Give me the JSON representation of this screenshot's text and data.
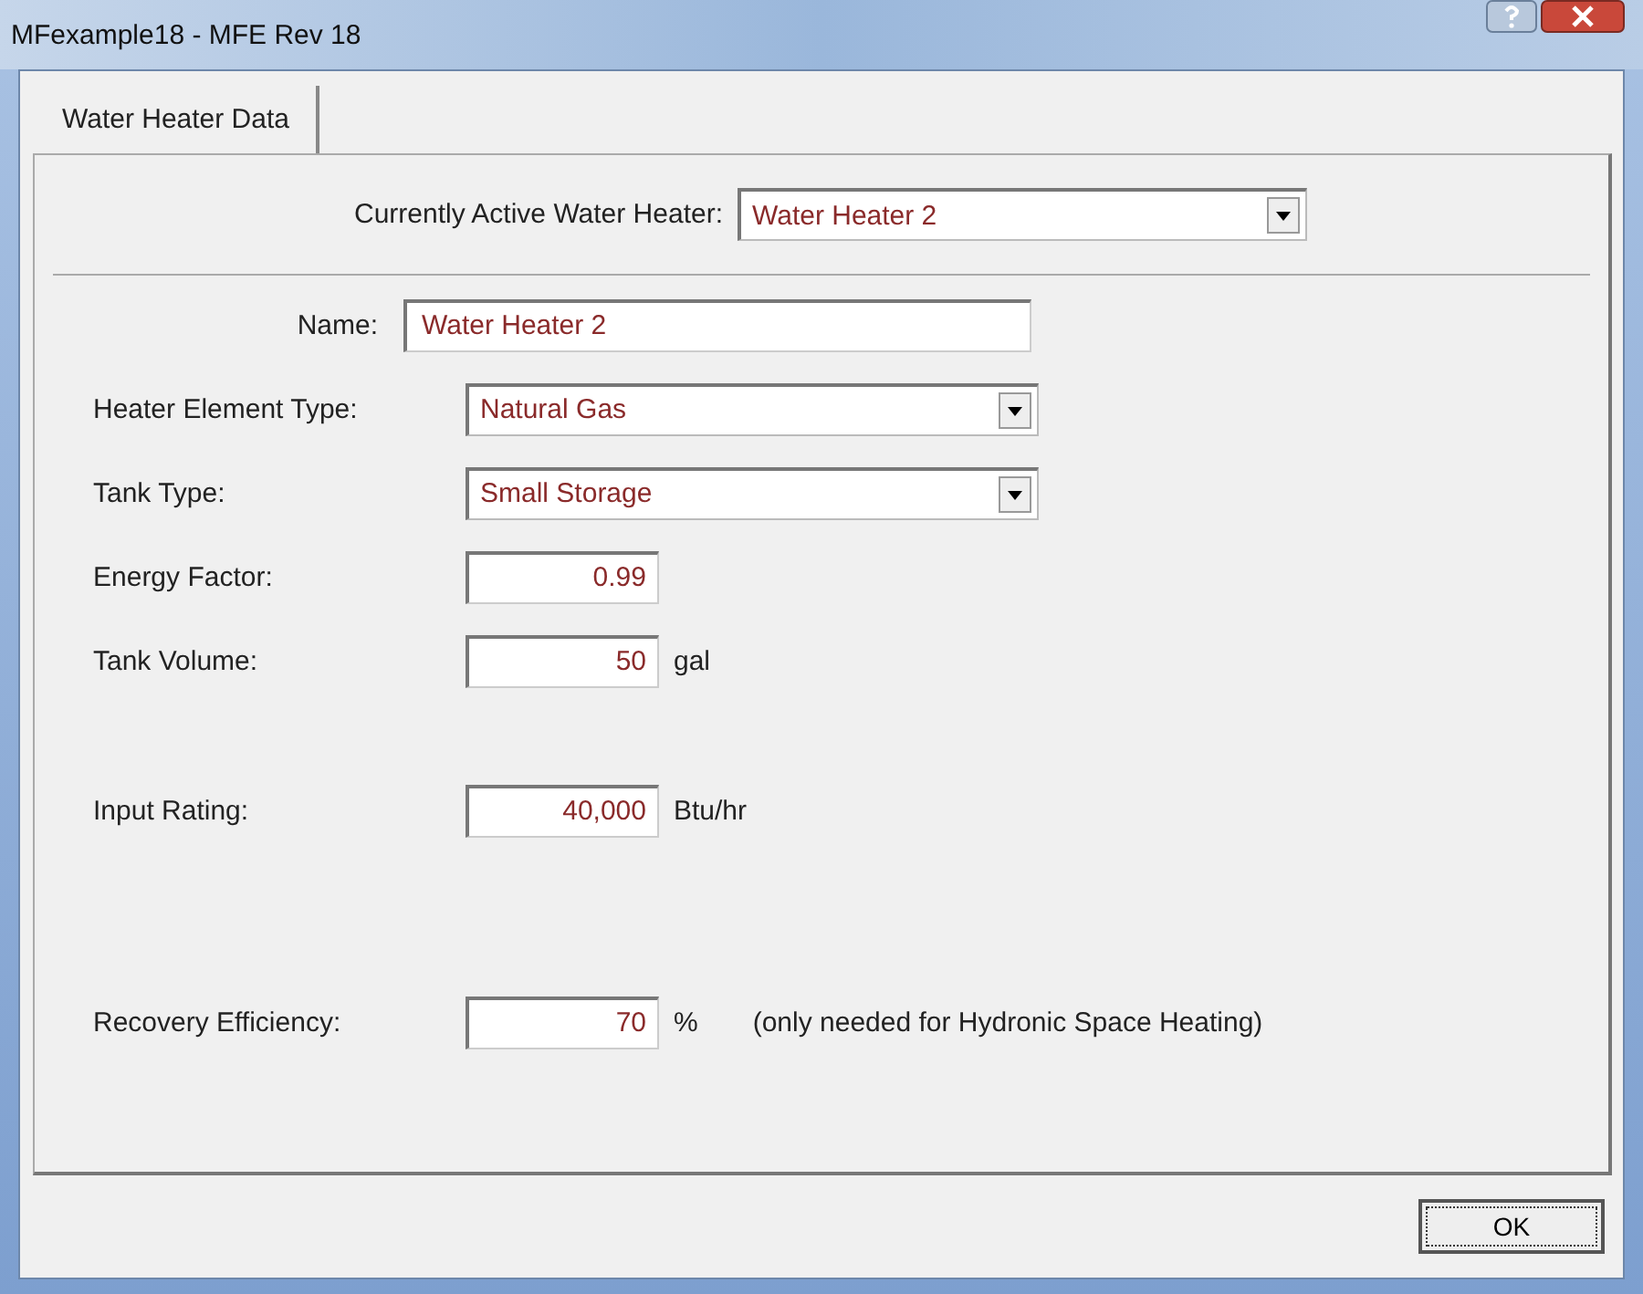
{
  "window": {
    "title": "MFexample18 - MFE Rev 18"
  },
  "tabs": [
    {
      "label": "Water Heater Data",
      "selected": true
    }
  ],
  "active_heater": {
    "label": "Currently Active Water Heater:",
    "value": "Water Heater 2"
  },
  "fields": [
    {
      "kind": "text",
      "label": "Name:",
      "value": "Water Heater 2"
    },
    {
      "kind": "select",
      "label": "Heater Element Type:",
      "value": "Natural Gas"
    },
    {
      "kind": "select",
      "label": "Tank Type:",
      "value": "Small Storage"
    },
    {
      "kind": "number",
      "label": "Energy Factor:",
      "value": "0.99"
    },
    {
      "kind": "number",
      "label": "Tank Volume:",
      "value": "50",
      "unit": "gal"
    },
    {
      "kind": "number",
      "label": "Input Rating:",
      "value": "40,000",
      "unit": "Btu/hr"
    },
    {
      "kind": "number",
      "label": "Recovery Efficiency:",
      "value": "70",
      "unit": "%",
      "note": "(only needed for Hydronic Space Heating)"
    }
  ],
  "buttons": [
    "OK"
  ]
}
